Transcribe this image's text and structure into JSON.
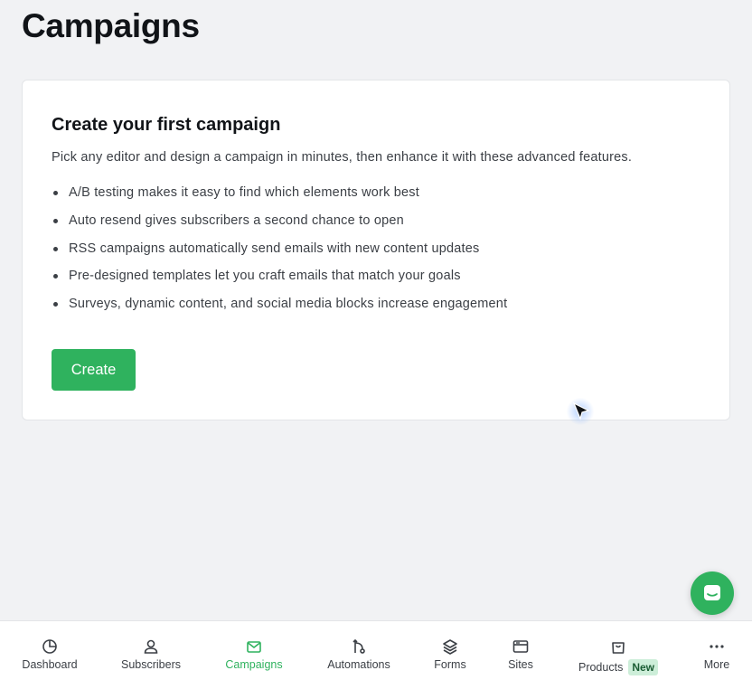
{
  "page": {
    "title": "Campaigns"
  },
  "card": {
    "title": "Create your first campaign",
    "description": "Pick any editor and design a campaign in minutes, then enhance it with these advanced features.",
    "features": [
      "A/B testing makes it easy to find which elements work best",
      "Auto resend gives subscribers a second chance to open",
      "RSS campaigns automatically send emails with new content updates",
      "Pre-designed templates let you craft emails that match your goals",
      "Surveys, dynamic content, and social media blocks increase engagement"
    ],
    "create_label": "Create"
  },
  "nav": {
    "items": [
      {
        "label": "Dashboard",
        "icon": "clock-pie-icon"
      },
      {
        "label": "Subscribers",
        "icon": "user-icon"
      },
      {
        "label": "Campaigns",
        "icon": "mail-icon",
        "active": true
      },
      {
        "label": "Automations",
        "icon": "branch-icon"
      },
      {
        "label": "Forms",
        "icon": "layers-icon"
      },
      {
        "label": "Sites",
        "icon": "browser-window-icon"
      },
      {
        "label": "Products",
        "icon": "shopping-bag-icon",
        "badge": "New"
      },
      {
        "label": "More",
        "icon": "ellipsis-icon"
      }
    ]
  },
  "colors": {
    "accent": "#2fb25e",
    "background": "#f1f2f4",
    "badge_bg": "#cdeed9"
  }
}
